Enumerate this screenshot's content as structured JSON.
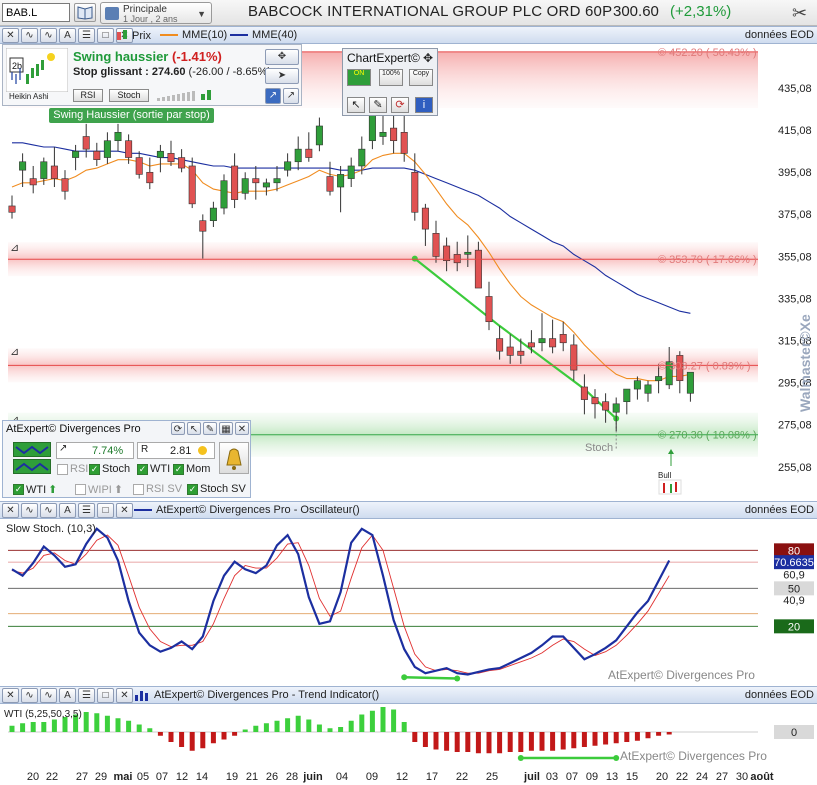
{
  "toolbar": {
    "symbol": "BAB.L",
    "period_line1": "Principale",
    "period_line2": "1 Jour , 2 ans",
    "title": "BABCOCK INTERNATIONAL GROUP PLC ORD 60P",
    "last_price": "300.60",
    "change": "(+2,31%)",
    "icons": [
      "book-icon",
      "calendar-icon",
      "tools-icon"
    ]
  },
  "main_panel": {
    "legend": {
      "price": "Prix",
      "mme10": "MME(10)",
      "mme40": "MME(40)"
    },
    "data_label": "données EOD",
    "colors": {
      "up": "#2f9e3a",
      "down": "#e05252",
      "mme10": "#f08c20",
      "mme40": "#1c2fa0",
      "support": "#36a84a",
      "resistance": "#e54848"
    },
    "price_axis": [
      "435,08",
      "415,08",
      "395,08",
      "375,08",
      "355,08",
      "335,08",
      "315,08",
      "295,08",
      "275,08",
      "255,08"
    ],
    "levels": [
      {
        "label": "© 452.20 ( 50.43% )",
        "value": 452.2,
        "type": "resistance"
      },
      {
        "label": "© 353.70 ( 17.66% )",
        "value": 353.7,
        "type": "resistance"
      },
      {
        "label": "© 303.27 ( 0.89% )",
        "value": 303.27,
        "type": "resistance"
      },
      {
        "label": "© 270.30 ( 10.08% )",
        "value": 270.3,
        "type": "support"
      }
    ],
    "stoch_annotation": "Stoch",
    "bull_label": "Bull",
    "watermark": "Walmaster©Xe"
  },
  "swing_box": {
    "title": "Swing haussier",
    "pct": "(-1.41%)",
    "stop": "Stop glissant : 274.60",
    "stop_detail": "(-26.00 / -8.65%)",
    "heikin": "Heikin Ashi",
    "rsi_btn": "RSI",
    "stoch_btn": "Stoch",
    "badge": "2b",
    "tag": "Swing Haussier (sortie par stop)"
  },
  "chartexpert": {
    "title": "ChartExpert©",
    "buttons": [
      "ON",
      "100%",
      "Copy"
    ]
  },
  "atexpert": {
    "title": "AtExpert© Divergences Pro",
    "pct": "7.74%",
    "ratio": "2.81",
    "rsi": "RSI",
    "stoch": "Stoch",
    "wti": "WTI",
    "mom": "Mom",
    "wti2": "WTI",
    "wipi": "WIPI",
    "rsisv": "RSI SV",
    "stochsv": "Stoch SV"
  },
  "stoch_panel": {
    "header": "AtExpert© Divergences Pro - Oscillateur()",
    "label": "Slow Stoch. (10,3)",
    "data_label": "données EOD",
    "axis": {
      "top": "80",
      "current": "70.6635",
      "v1": "60,9",
      "mid": "50",
      "v2": "40,9",
      "bottom": "20"
    },
    "watermark": "AtExpert© Divergences Pro",
    "k": [
      65,
      60,
      70,
      83,
      76,
      67,
      69,
      85,
      97,
      90,
      72,
      40,
      15,
      5,
      0,
      3,
      8,
      2,
      12,
      40,
      60,
      71,
      65,
      62,
      68,
      84,
      92,
      77,
      43,
      22,
      24,
      47,
      86,
      97,
      92,
      60,
      25,
      2,
      -12,
      -17,
      -15,
      -13,
      -17,
      -18,
      -16,
      -14,
      -13,
      -9,
      -5,
      -1,
      5,
      12,
      12,
      3,
      -6,
      -2,
      3,
      9,
      20,
      31,
      40,
      56,
      72
    ],
    "d": [
      64,
      62,
      66,
      76,
      78,
      72,
      69,
      77,
      88,
      92,
      84,
      60,
      35,
      18,
      8,
      4,
      5,
      5,
      8,
      22,
      42,
      60,
      68,
      66,
      66,
      74,
      85,
      86,
      68,
      42,
      28,
      32,
      58,
      82,
      92,
      80,
      50,
      20,
      -2,
      -12,
      -15,
      -14,
      -15,
      -17,
      -17,
      -15,
      -14,
      -11,
      -8,
      -5,
      -1,
      5,
      10,
      8,
      2,
      -3,
      0,
      5,
      13,
      22,
      32,
      46,
      60
    ]
  },
  "wti_panel": {
    "header": "AtExpert© Divergences Pro - Trend Indicator()",
    "label": "WTI (5,25,50,3,5)",
    "data_label": "données EOD",
    "axis_zero": "0",
    "watermark": "AtExpert© Divergences Pro",
    "bars": [
      5,
      7,
      8,
      8,
      10,
      12,
      14,
      16,
      15,
      13,
      11,
      9,
      6,
      3,
      -3,
      -8,
      -12,
      -15,
      -13,
      -9,
      -6,
      -3,
      2,
      5,
      7,
      9,
      11,
      13,
      10,
      6,
      3,
      4,
      9,
      14,
      17,
      20,
      18,
      8,
      -8,
      -12,
      -14,
      -15,
      -16,
      -16,
      -17,
      -17,
      -17,
      -16,
      -16,
      -15,
      -15,
      -15,
      -14,
      -13,
      -12,
      -11,
      -10,
      -9,
      -8,
      -7,
      -5,
      -3,
      -2
    ]
  },
  "date_axis": {
    "labels": [
      "20",
      "22",
      "27",
      "29",
      "mai",
      "05",
      "07",
      "12",
      "14",
      "19",
      "21",
      "26",
      "28",
      "juin",
      "04",
      "09",
      "12",
      "17",
      "22",
      "25",
      "juil",
      "03",
      "07",
      "09",
      "13",
      "15",
      "20",
      "22",
      "24",
      "27",
      "30",
      "août"
    ]
  },
  "chart_data": {
    "type": "candlestick",
    "title": "BABCOCK INTERNATIONAL GROUP PLC ORD 60P",
    "ylim": [
      245,
      455
    ],
    "ohlc": [
      [
        379,
        384,
        373,
        376
      ],
      [
        396,
        404,
        388,
        400
      ],
      [
        392,
        398,
        385,
        389
      ],
      [
        392,
        402,
        389,
        400
      ],
      [
        398,
        407,
        388,
        392
      ],
      [
        392,
        396,
        382,
        386
      ],
      [
        402,
        408,
        396,
        405
      ],
      [
        412,
        418,
        402,
        406
      ],
      [
        405,
        409,
        398,
        401
      ],
      [
        402,
        414,
        399,
        410
      ],
      [
        410,
        418,
        405,
        414
      ],
      [
        410,
        413,
        399,
        402
      ],
      [
        402,
        405,
        392,
        394
      ],
      [
        395,
        402,
        387,
        390
      ],
      [
        402,
        408,
        395,
        405
      ],
      [
        404,
        410,
        398,
        400
      ],
      [
        402,
        406,
        395,
        397
      ],
      [
        398,
        402,
        378,
        380
      ],
      [
        372,
        375,
        354,
        367
      ],
      [
        372,
        381,
        369,
        378
      ],
      [
        378,
        394,
        375,
        391
      ],
      [
        398,
        404,
        378,
        382
      ],
      [
        385,
        395,
        382,
        392
      ],
      [
        392,
        398,
        382,
        390
      ],
      [
        388,
        392,
        384,
        390
      ],
      [
        390,
        398,
        386,
        392
      ],
      [
        396,
        404,
        393,
        400
      ],
      [
        400,
        412,
        396,
        406
      ],
      [
        406,
        414,
        400,
        402
      ],
      [
        408,
        421,
        405,
        417
      ],
      [
        393,
        400,
        384,
        386
      ],
      [
        388,
        398,
        376,
        394
      ],
      [
        392,
        402,
        388,
        398
      ],
      [
        398,
        412,
        394,
        406
      ],
      [
        410,
        438,
        406,
        432
      ],
      [
        412,
        434,
        408,
        414
      ],
      [
        416,
        440,
        404,
        410
      ],
      [
        414,
        428,
        400,
        404
      ],
      [
        395,
        404,
        372,
        376
      ],
      [
        378,
        380,
        360,
        368
      ],
      [
        366,
        372,
        352,
        355
      ],
      [
        360,
        364,
        348,
        353
      ],
      [
        356,
        362,
        348,
        352
      ],
      [
        356,
        365,
        350,
        357
      ],
      [
        358,
        362,
        342,
        340
      ],
      [
        336,
        343,
        320,
        324
      ],
      [
        316,
        322,
        306,
        310
      ],
      [
        312,
        318,
        304,
        308
      ],
      [
        310,
        316,
        304,
        308
      ],
      [
        314,
        320,
        309,
        312
      ],
      [
        314,
        328,
        310,
        316
      ],
      [
        316,
        325,
        309,
        312
      ],
      [
        318,
        324,
        310,
        314
      ],
      [
        313,
        318,
        296,
        301
      ],
      [
        293,
        299,
        280,
        287
      ],
      [
        288,
        292,
        278,
        285
      ],
      [
        286,
        290,
        276,
        282
      ],
      [
        281,
        288,
        272,
        285
      ],
      [
        286,
        292,
        280,
        292
      ],
      [
        292,
        298,
        287,
        296
      ],
      [
        290,
        296,
        286,
        294
      ],
      [
        296,
        304,
        290,
        298
      ],
      [
        294,
        312,
        292,
        305
      ],
      [
        308,
        310,
        290,
        296
      ],
      [
        290,
        300,
        286,
        300
      ]
    ],
    "mme10": [
      388,
      390,
      390,
      391,
      392,
      391,
      393,
      396,
      397,
      399,
      401,
      401,
      400,
      398,
      399,
      399,
      399,
      396,
      390,
      387,
      386,
      385,
      386,
      386,
      386,
      387,
      389,
      391,
      393,
      396,
      394,
      393,
      394,
      396,
      401,
      403,
      404,
      404,
      400,
      394,
      387,
      380,
      374,
      370,
      364,
      357,
      349,
      342,
      336,
      332,
      329,
      326,
      324,
      319,
      313,
      308,
      303,
      299,
      297,
      297,
      296,
      296,
      298,
      298,
      299
    ],
    "mme40": [
      409,
      409,
      408,
      407,
      407,
      406,
      405,
      405,
      405,
      405,
      405,
      404,
      404,
      403,
      402,
      402,
      401,
      400,
      399,
      398,
      398,
      397,
      397,
      397,
      397,
      397,
      397,
      397,
      397,
      397,
      397,
      396,
      396,
      396,
      397,
      397,
      397,
      397,
      396,
      394,
      392,
      390,
      388,
      386,
      384,
      381,
      378,
      374,
      371,
      368,
      365,
      362,
      360,
      356,
      353,
      350,
      346,
      343,
      340,
      337,
      335,
      333,
      331,
      329,
      328
    ]
  }
}
